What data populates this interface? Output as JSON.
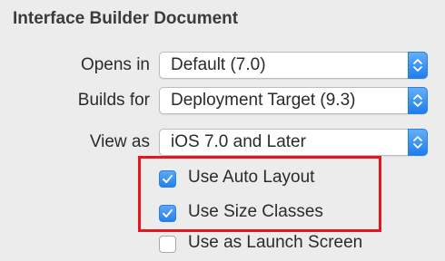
{
  "section": {
    "title": "Interface Builder Document"
  },
  "rows": {
    "opens_in": {
      "label": "Opens in",
      "value": "Default (7.0)"
    },
    "builds_for": {
      "label": "Builds for",
      "value": "Deployment Target (9.3)"
    },
    "view_as": {
      "label": "View as",
      "value": "iOS 7.0 and Later"
    }
  },
  "checkboxes": {
    "auto_layout": {
      "label": "Use Auto Layout",
      "checked": true
    },
    "size_classes": {
      "label": "Use Size Classes",
      "checked": true
    },
    "launch_screen": {
      "label": "Use as Launch Screen",
      "checked": false
    }
  },
  "icons": {
    "popup_arrow": "chevron-up-down-icon",
    "checkmark": "checkmark-icon"
  },
  "colors": {
    "accent": "#1f80f0",
    "highlight": "#e8141e",
    "background": "#ececec"
  }
}
